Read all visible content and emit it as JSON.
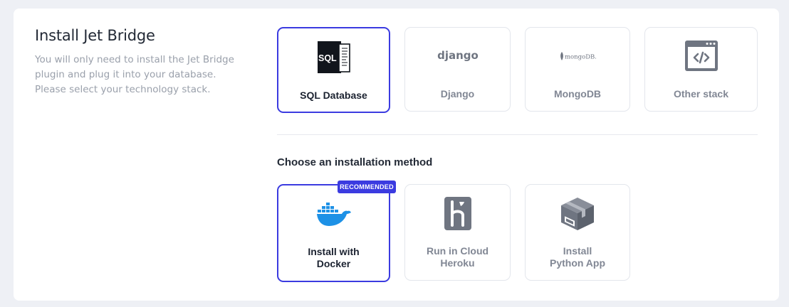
{
  "intro": {
    "title": "Install Jet Bridge",
    "description": "You will only need to install the Jet Bridge plugin and plug it into your database. Please select your technology stack."
  },
  "stacks": [
    {
      "label": "SQL Database",
      "icon": "sql-database-icon",
      "selected": true
    },
    {
      "label": "Django",
      "icon": "django-logo-icon",
      "logo_text": "django",
      "selected": false
    },
    {
      "label": "MongoDB",
      "icon": "mongodb-logo-icon",
      "logo_text": "mongoDB.",
      "selected": false
    },
    {
      "label": "Other stack",
      "icon": "code-window-icon",
      "selected": false
    }
  ],
  "method_section": {
    "title": "Choose an installation method",
    "badge": "RECOMMENDED"
  },
  "methods": [
    {
      "label": "Install with\nDocker",
      "icon": "docker-whale-icon",
      "selected": true
    },
    {
      "label": "Run in Cloud\nHeroku",
      "icon": "heroku-icon",
      "selected": false
    },
    {
      "label": "Install\nPython App",
      "icon": "python-package-icon",
      "selected": false
    }
  ],
  "colors": {
    "accent": "#3b3be0",
    "docker": "#1d91e6",
    "icon_gray": "#6f7581",
    "background": "#eef0f5"
  }
}
